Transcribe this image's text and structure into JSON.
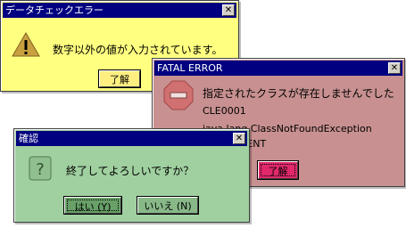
{
  "dialogs": {
    "data_check": {
      "title": "データチェックエラー",
      "message": "数字以外の値が入力されています。",
      "ok_label": "了解",
      "icon": "warning-icon",
      "bg_color": "#ffff80"
    },
    "fatal": {
      "title": "FATAL ERROR",
      "message": "指定されたクラスが存在しませんでした",
      "code": "CLE0001",
      "exception": "java.lang.ClassNotFoundException",
      "component": "COMPONENT",
      "ok_label": "了解",
      "icon": "stop-icon",
      "bg_color": "#c89090"
    },
    "confirm": {
      "title": "確認",
      "message": "終了してよろしいですか？",
      "yes_label": "はい (Y)",
      "no_label": "いいえ (N)",
      "icon": "question-icon",
      "bg_color": "#a0d0a0"
    },
    "close_glyph": "✕"
  }
}
